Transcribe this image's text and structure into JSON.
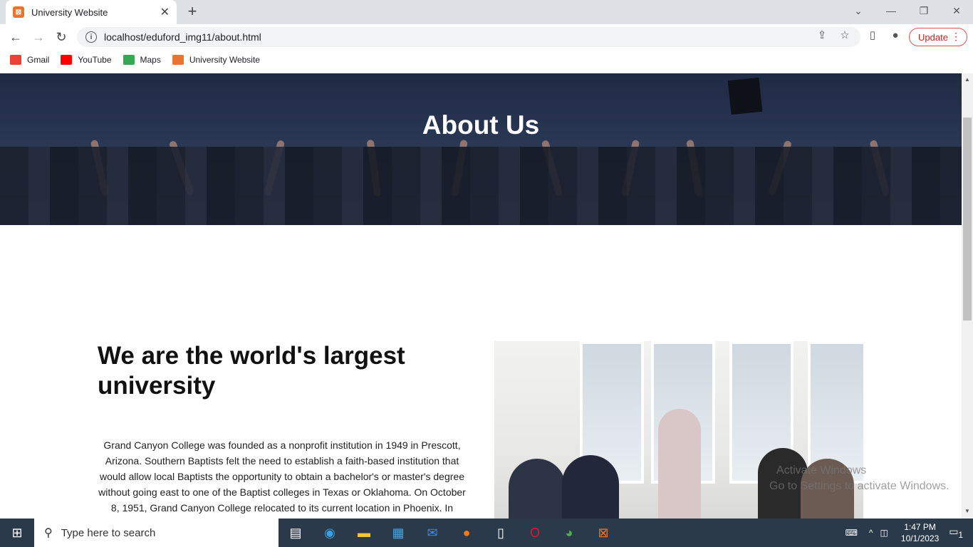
{
  "tab": {
    "title": "University Website",
    "favicon": "xampp-icon"
  },
  "address": {
    "url": "localhost/eduford_img11/about.html"
  },
  "toolbar": {
    "update_label": "Update"
  },
  "bookmarks": [
    {
      "label": "Gmail",
      "icon": "gmail-icon",
      "color": "#ea4335"
    },
    {
      "label": "YouTube",
      "icon": "youtube-icon",
      "color": "#ff0000"
    },
    {
      "label": "Maps",
      "icon": "maps-icon",
      "color": "#34a853"
    },
    {
      "label": "University Website",
      "icon": "xampp-icon",
      "color": "#e8742f"
    }
  ],
  "page": {
    "hero_title": "About Us",
    "heading": "We are the world's largest university",
    "paragraph": "Grand Canyon College was founded as a nonprofit institution in 1949 in Prescott, Arizona. Southern Baptists felt the need to establish a faith-based institution that would allow local Baptists the opportunity to obtain a bachelor's or master's degree without going east to one of the Baptist colleges in Texas or Oklahoma. On October 8, 1951, Grand Canyon College relocated to its current location in Phoenix. In"
  },
  "watermark": {
    "line1": "Activate Windows",
    "line2": "Go to Settings to activate Windows."
  },
  "taskbar": {
    "search_placeholder": "Type here to search",
    "time": "1:47 PM",
    "date": "10/1/2023",
    "notif_count": "1"
  }
}
